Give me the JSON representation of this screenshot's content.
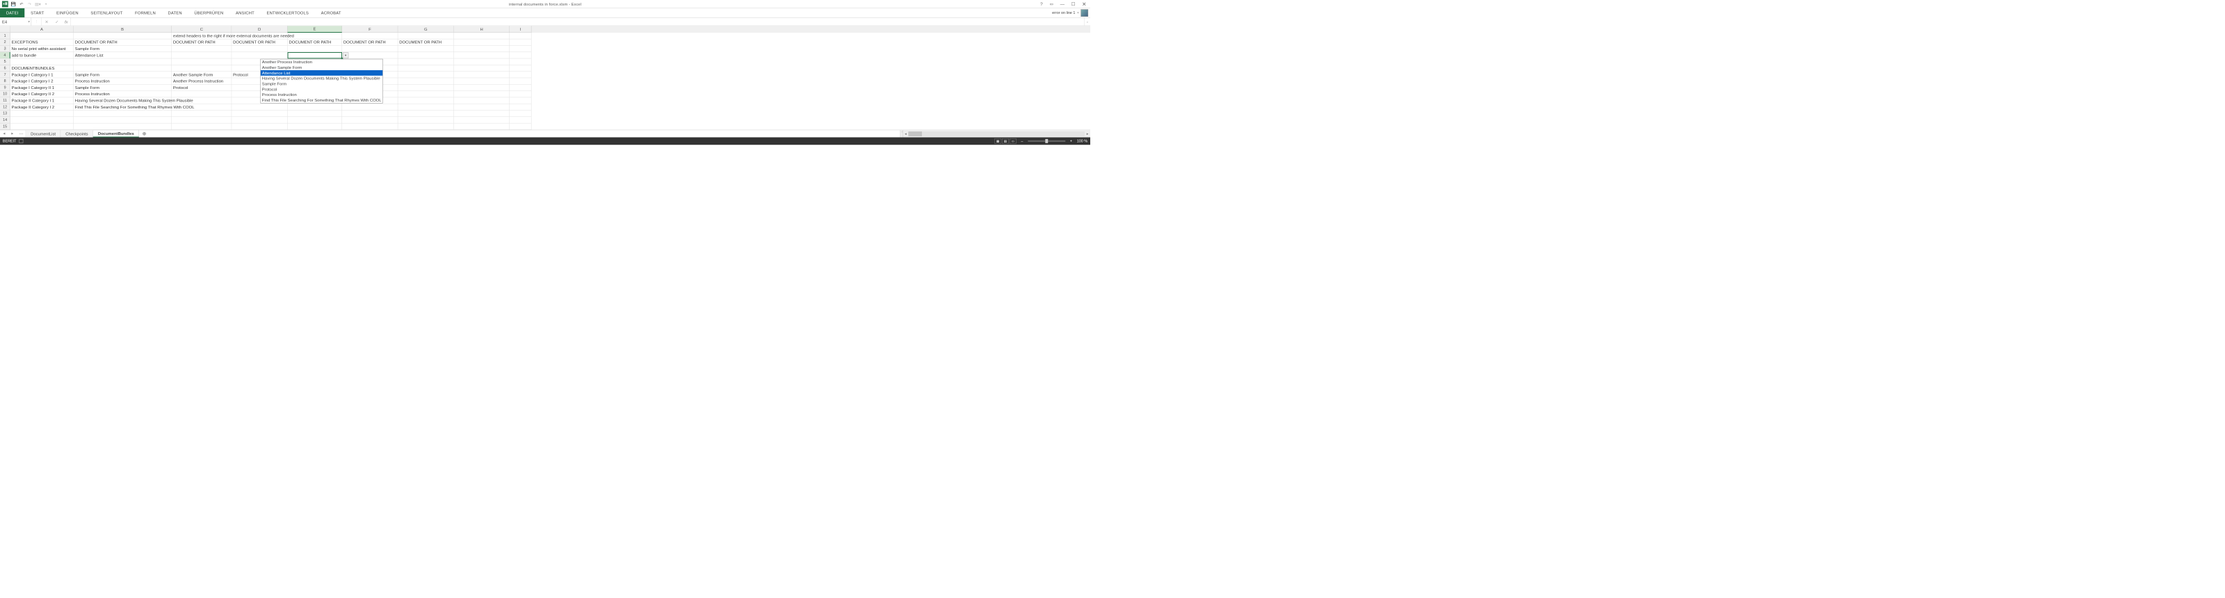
{
  "window": {
    "title": "internal documents in force.xlsm - Excel"
  },
  "ribbon": {
    "tabs": [
      "DATEI",
      "START",
      "EINFÜGEN",
      "SEITENLAYOUT",
      "FORMELN",
      "DATEN",
      "ÜBERPRÜFEN",
      "ANSICHT",
      "ENTWICKLERTOOLS",
      "ACROBAT"
    ],
    "error": "error on line 1"
  },
  "formula_bar": {
    "name_box": "E4",
    "fx_label": "fx",
    "value": ""
  },
  "columns": [
    "A",
    "B",
    "C",
    "D",
    "E",
    "F",
    "G",
    "H",
    "I"
  ],
  "active_col_idx": 4,
  "row_count": 15,
  "active_row": 4,
  "cells": {
    "r1": {
      "C": "extend headers to the right if more external documents are needed"
    },
    "r2": {
      "A": "EXCEPTIONS",
      "B": "DOCUMENT OR PATH",
      "C": "DOCUMENT OR PATH",
      "D": "DOCUMENT OR PATH",
      "E": "DOCUMENT OR PATH",
      "F": "DOCUMENT OR PATH",
      "G": "DOCUMENT OR PATH"
    },
    "r3": {
      "A": "No serial print within assistant",
      "B": "Sample Form"
    },
    "r4": {
      "A": "add to bundle",
      "B": "Attendance List"
    },
    "r5": {},
    "r6": {
      "A": "DOCUMENTBUNDLES"
    },
    "r7": {
      "A": "Package I Category I 1",
      "B": "Sample Form",
      "C": "Another Sample Form",
      "D": "Protocol"
    },
    "r8": {
      "A": "Package I Category I 2",
      "B": "Process Instruction",
      "C": "Another Process Instruction"
    },
    "r9": {
      "A": "Package I Category II 1",
      "B": "Sample Form",
      "C": "Protocol"
    },
    "r10": {
      "A": "Package I Category II 2",
      "B": "Process Instruction"
    },
    "r11": {
      "A": "Package II Category I 1",
      "B": "Having Several Dozen Documents Making This System Plausible"
    },
    "r12": {
      "A": "Package II Category I 2",
      "B": "Find This File Searching For Something That Rhymes With COOL"
    }
  },
  "dropdown": {
    "items": [
      "Another Process Instruction",
      "Another Sample Form",
      "Attendance List",
      "Having Several Dozen Documents Making This System Plausible",
      "Sample Form",
      "Protocol",
      "Process Instruction",
      "Find This File Searching For Something That Rhymes With COOL"
    ],
    "selected_idx": 2
  },
  "sheets": {
    "tabs": [
      "DocumentList",
      "Checkpoints",
      "DocumentBundles"
    ],
    "active_idx": 2
  },
  "status": {
    "ready": "BEREIT",
    "zoom": "100 %",
    "plus": "+",
    "minus": "–"
  }
}
